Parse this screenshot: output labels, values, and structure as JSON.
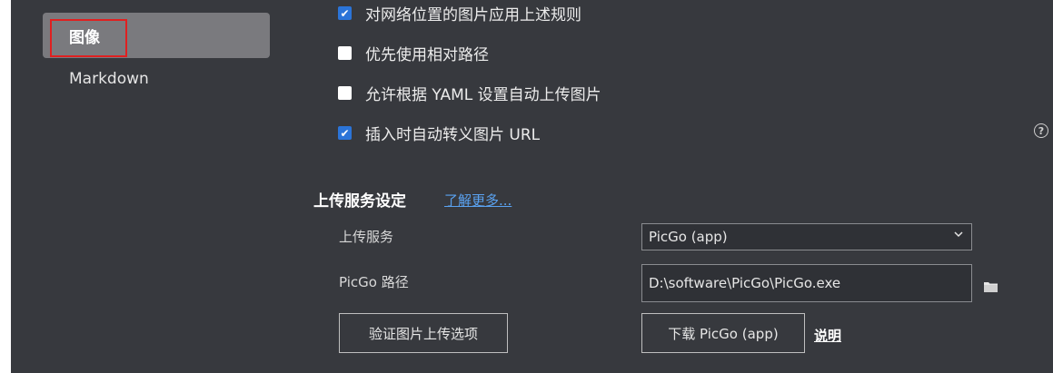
{
  "sidebar": {
    "items": [
      {
        "label": "图像"
      },
      {
        "label": "Markdown"
      }
    ]
  },
  "options": {
    "apply_network_rule": {
      "label": "对网络位置的图片应用上述规则",
      "checked": true
    },
    "prefer_relative": {
      "label": "优先使用相对路径",
      "checked": false
    },
    "yaml_auto_upload": {
      "label": "允许根据 YAML 设置自动上传图片",
      "checked": false
    },
    "escape_url": {
      "label": "插入时自动转义图片 URL",
      "checked": true
    }
  },
  "upload": {
    "section_title": "上传服务设定",
    "learn_more": "了解更多...",
    "service_label": "上传服务",
    "service_value": "PicGo (app)",
    "path_label": "PicGo 路径",
    "path_value": "D:\\software\\PicGo\\PicGo.exe",
    "verify_button": "验证图片上传选项",
    "download_button": "下载 PicGo (app)",
    "explain_link": "说明"
  },
  "icons": {
    "help": "question-circle-icon",
    "folder": "folder-icon",
    "chevron": "chevron-down-icon",
    "check": "checkmark-icon"
  },
  "colors": {
    "background": "#37393e",
    "active_item": "#7a7a7e",
    "highlight": "#e02020",
    "checkbox_checked": "#2b74d8",
    "link": "#5aa2f0"
  }
}
